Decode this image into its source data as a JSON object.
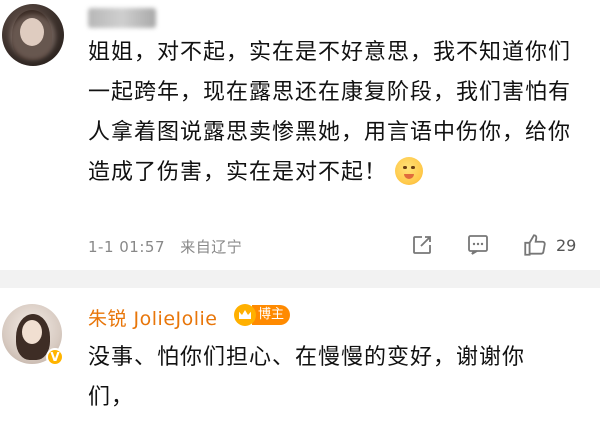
{
  "comment1": {
    "username": "",
    "text": "姐姐，对不起，实在是不好意思，我不知道你们一起跨年，现在露思还在康复阶段，我们害怕有人拿着图说露思卖惨黑她，用言语中伤你，给你造成了伤害，实在是对不起！",
    "emoji": "pleading-face-emoji",
    "timestamp": "1-1 01:57",
    "location": "来自辽宁",
    "like_count": "29"
  },
  "comment2": {
    "username": "朱锐 JolieJolie",
    "host_badge": "博主",
    "verified": "V",
    "text_line1": "没事、怕你们担心、在慢慢的变好，谢谢你",
    "text_line2": "们，"
  },
  "colors": {
    "name": "#e8760a",
    "host_badge": "#ff8a00",
    "divider": "#f2f2f2"
  }
}
